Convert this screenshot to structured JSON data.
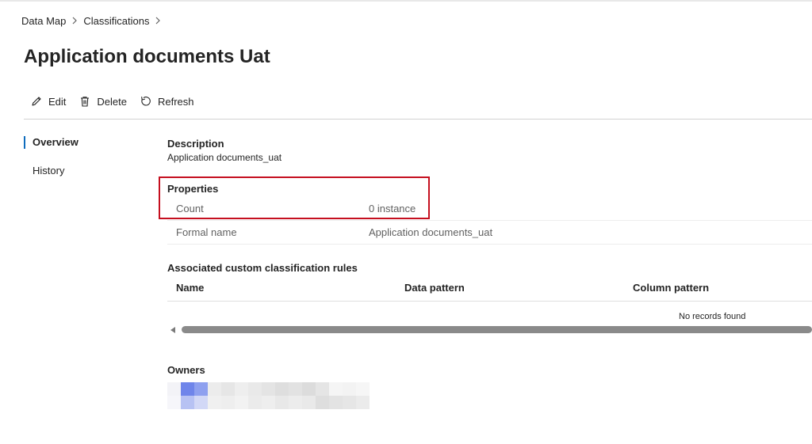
{
  "breadcrumb": {
    "items": [
      "Data Map",
      "Classifications"
    ]
  },
  "page": {
    "title": "Application documents Uat"
  },
  "toolbar": {
    "edit_label": "Edit",
    "delete_label": "Delete",
    "refresh_label": "Refresh"
  },
  "nav": {
    "overview_label": "Overview",
    "history_label": "History"
  },
  "description": {
    "label": "Description",
    "value": "Application documents_uat"
  },
  "properties": {
    "label": "Properties",
    "rows": [
      {
        "key": "Count",
        "value": "0 instance"
      },
      {
        "key": "Formal name",
        "value": "Application documents_uat"
      }
    ]
  },
  "rules": {
    "label": "Associated custom classification rules",
    "columns": [
      "Name",
      "Data pattern",
      "Column pattern"
    ],
    "empty_text": "No records found"
  },
  "owners": {
    "label": "Owners"
  },
  "colors": {
    "accent": "#0f6cbd",
    "highlight": "#c50f1f"
  }
}
